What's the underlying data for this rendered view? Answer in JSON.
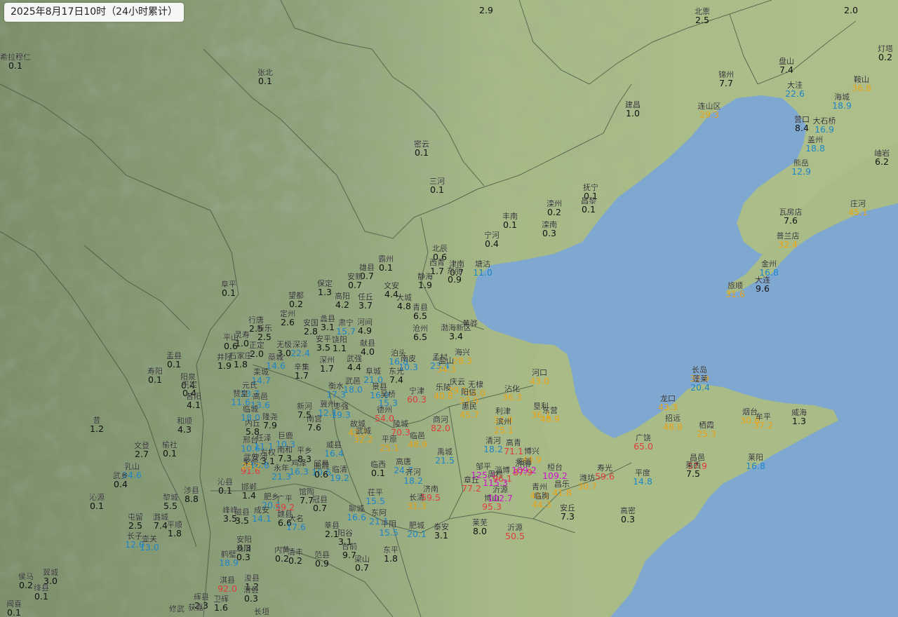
{
  "header": {
    "title": "2025年8月17日10时（24小时累计）"
  },
  "colors": {
    "sea": "#7ea8cf",
    "plain": "#a8bb86",
    "mountain": "#7f936d",
    "border": "#3a4a3a",
    "r0": "#111111",
    "r10": "#1f86c8",
    "r25": "#e8a317",
    "r50": "#e03c3c",
    "r100": "#cc14cc"
  },
  "stations": [
    {
      "name": "",
      "value": "2.9"
    },
    {
      "name": "",
      "value": "2.0"
    },
    {
      "name": "北票",
      "value": "2.5"
    },
    {
      "name": "希拉穆仁",
      "value": "0.1"
    },
    {
      "name": "张北",
      "value": "0.1"
    },
    {
      "name": "盘山",
      "value": "7.4"
    },
    {
      "name": "灯塔",
      "value": "0.2"
    },
    {
      "name": "锦州",
      "value": "7.7"
    },
    {
      "name": "鞍山",
      "value": "36.8"
    },
    {
      "name": "大洼",
      "value": "22.6"
    },
    {
      "name": "海城",
      "value": "18.9"
    },
    {
      "name": "建昌",
      "value": "1.0"
    },
    {
      "name": "连山区",
      "value": "29.3"
    },
    {
      "name": "营口",
      "value": "8.4"
    },
    {
      "name": "大石桥",
      "value": "16.9"
    },
    {
      "name": "盖州",
      "value": "18.8"
    },
    {
      "name": "岫岩",
      "value": "6.2"
    },
    {
      "name": "密云",
      "value": "0.1"
    },
    {
      "name": "熊岳",
      "value": "12.9"
    },
    {
      "name": "三河",
      "value": "0.1"
    },
    {
      "name": "抚宁",
      "value": "0.1"
    },
    {
      "name": "昌黎",
      "value": "0.1"
    },
    {
      "name": "滦州",
      "value": "0.2"
    },
    {
      "name": "庄河",
      "value": "45.1"
    },
    {
      "name": "丰南",
      "value": "0.1"
    },
    {
      "name": "滦南",
      "value": "0.3"
    },
    {
      "name": "瓦房店",
      "value": "7.6"
    },
    {
      "name": "宁河",
      "value": "0.4"
    },
    {
      "name": "普兰店",
      "value": "32.4"
    },
    {
      "name": "北辰",
      "value": "0.6"
    },
    {
      "name": "霸州",
      "value": "0.1"
    },
    {
      "name": "西青",
      "value": "1.7"
    },
    {
      "name": "津南",
      "value": "0.7"
    },
    {
      "name": "东丽",
      "value": "0.9"
    },
    {
      "name": "塘沽",
      "value": "11.0"
    },
    {
      "name": "雄县",
      "value": "0.7"
    },
    {
      "name": "金州",
      "value": "16.8"
    },
    {
      "name": "安新",
      "value": "0.7"
    },
    {
      "name": "静海",
      "value": "1.9"
    },
    {
      "name": "阜平",
      "value": "0.1"
    },
    {
      "name": "保定",
      "value": "1.3"
    },
    {
      "name": "文安",
      "value": "4.4"
    },
    {
      "name": "大连",
      "value": "9.6"
    },
    {
      "name": "旅顺",
      "value": "31.6"
    },
    {
      "name": "望都",
      "value": "0.2"
    },
    {
      "name": "高阳",
      "value": "4.2"
    },
    {
      "name": "任丘",
      "value": "3.7"
    },
    {
      "name": "大城",
      "value": "4.8"
    },
    {
      "name": "青县",
      "value": "6.5"
    },
    {
      "name": "定州",
      "value": "2.6"
    },
    {
      "name": "行唐",
      "value": "2.5"
    },
    {
      "name": "蠡县",
      "value": "3.1"
    },
    {
      "name": "安国",
      "value": "2.8"
    },
    {
      "name": "肃宁",
      "value": "15.7"
    },
    {
      "name": "河间",
      "value": "4.9"
    },
    {
      "name": "沧州",
      "value": "6.5"
    },
    {
      "name": "渤海新区",
      "value": "3.4"
    },
    {
      "name": "黄骅",
      "value": ""
    },
    {
      "name": "新乐",
      "value": "2.5"
    },
    {
      "name": "灵寿",
      "value": "1.0"
    },
    {
      "name": "平山",
      "value": "0.6"
    },
    {
      "name": "无极",
      "value": "3.0"
    },
    {
      "name": "深泽",
      "value": "22.4"
    },
    {
      "name": "安平",
      "value": "3.5"
    },
    {
      "name": "饶阳",
      "value": "1.1"
    },
    {
      "name": "献县",
      "value": "4.0"
    },
    {
      "name": "石家庄",
      "value": "1.8"
    },
    {
      "name": "正定",
      "value": "2.0"
    },
    {
      "name": "盂县",
      "value": "0.1"
    },
    {
      "name": "井陉",
      "value": "1.9"
    },
    {
      "name": "藁城",
      "value": "14.6"
    },
    {
      "name": "泊头",
      "value": "16.8"
    },
    {
      "name": "南皮",
      "value": "10.3"
    },
    {
      "name": "孟村",
      "value": "23.4"
    },
    {
      "name": "盐山",
      "value": "34.3"
    },
    {
      "name": "海兴",
      "value": "28.3"
    },
    {
      "name": "寿阳",
      "value": "0.1"
    },
    {
      "name": "深州",
      "value": "1.7"
    },
    {
      "name": "武强",
      "value": "4.4"
    },
    {
      "name": "阜城",
      "value": "21.0"
    },
    {
      "name": "辛集",
      "value": "1.7"
    },
    {
      "name": "栾城",
      "value": "14.7"
    },
    {
      "name": "东光",
      "value": "7.4"
    },
    {
      "name": "阳泉",
      "value": "0.4"
    },
    {
      "name": "平定",
      "value": "0.4"
    },
    {
      "name": "元氏",
      "value": "23.7"
    },
    {
      "name": "武邑",
      "value": "18.0"
    },
    {
      "name": "河口",
      "value": "43.0"
    },
    {
      "name": "昔阳",
      "value": "4.1"
    },
    {
      "name": "衡水",
      "value": "17.3"
    },
    {
      "name": "景县",
      "value": "16.9"
    },
    {
      "name": "吴桥",
      "value": "15.3"
    },
    {
      "name": "宁津",
      "value": "60.3"
    },
    {
      "name": "乐陵",
      "value": "40.8"
    },
    {
      "name": "庆云",
      "value": "29.1"
    },
    {
      "name": "无棣",
      "value": "34.0"
    },
    {
      "name": "沾化",
      "value": "36.3"
    },
    {
      "name": "赞皇",
      "value": "11.6"
    },
    {
      "name": "高邑",
      "value": "13.6"
    },
    {
      "name": "阳信",
      "value": "33.0"
    },
    {
      "name": "垦利",
      "value": "36.1"
    },
    {
      "name": "长岛",
      "value": "32.9"
    },
    {
      "name": "蓬莱",
      "value": "20.4"
    },
    {
      "name": "临城",
      "value": "18.0"
    },
    {
      "name": "新河",
      "value": "7.5"
    },
    {
      "name": "冀州",
      "value": "12.1"
    },
    {
      "name": "枣强",
      "value": "19.3"
    },
    {
      "name": "德州",
      "value": "54.0"
    },
    {
      "name": "惠民",
      "value": "45.7"
    },
    {
      "name": "利津",
      "value": "34.8"
    },
    {
      "name": "东营",
      "value": "48.9"
    },
    {
      "name": "龙口",
      "value": "43.3"
    },
    {
      "name": "昔",
      "value": "1.2"
    },
    {
      "name": "和顺",
      "value": "4.3"
    },
    {
      "name": "内丘",
      "value": "5.8"
    },
    {
      "name": "隆尧",
      "value": "7.9"
    },
    {
      "name": "南宫",
      "value": "7.6"
    },
    {
      "name": "故城",
      "value": "42.3"
    },
    {
      "name": "陵城",
      "value": "70.3"
    },
    {
      "name": "商河",
      "value": "82.0"
    },
    {
      "name": "滨州",
      "value": "25.1"
    },
    {
      "name": "招远",
      "value": "48.8"
    },
    {
      "name": "烟台",
      "value": "30.8"
    },
    {
      "name": "牟平",
      "value": "37.2"
    },
    {
      "name": "威海",
      "value": "1.3"
    },
    {
      "name": "邢台",
      "value": "10.6"
    },
    {
      "name": "任泽",
      "value": "11.1"
    },
    {
      "name": "巨鹿",
      "value": "10.3"
    },
    {
      "name": "武城",
      "value": "32.2"
    },
    {
      "name": "平原",
      "value": "25.1"
    },
    {
      "name": "临邑",
      "value": "48.9"
    },
    {
      "name": "栖霞",
      "value": "25.3"
    },
    {
      "name": "文登",
      "value": "2.7"
    },
    {
      "name": "榆社",
      "value": "0.1"
    },
    {
      "name": "左权",
      "value": "3.1"
    },
    {
      "name": "南和",
      "value": "7.3"
    },
    {
      "name": "平乡",
      "value": "8.3"
    },
    {
      "name": "威县",
      "value": "16.4"
    },
    {
      "name": "清河",
      "value": "18.2"
    },
    {
      "name": "高青",
      "value": "71.1"
    },
    {
      "name": "博兴",
      "value": "44.9"
    },
    {
      "name": "广饶",
      "value": "65.0"
    },
    {
      "name": "莱州",
      "value": "91.6"
    },
    {
      "name": "沙河",
      "value": "10.6"
    },
    {
      "name": "鸡泽",
      "value": "16.3"
    },
    {
      "name": "邱县",
      "value": "10.6"
    },
    {
      "name": "临西",
      "value": "0.1"
    },
    {
      "name": "高唐",
      "value": "24.7"
    },
    {
      "name": "禹城",
      "value": "21.5"
    },
    {
      "name": "济阳",
      "value": "87.9"
    },
    {
      "name": "桓台",
      "value": "109.2"
    },
    {
      "name": "寿光",
      "value": "59.6"
    },
    {
      "name": "昌邑",
      "value": "57.9"
    },
    {
      "name": "莱阳",
      "value": "16.8"
    },
    {
      "name": "乳山",
      "value": "24.6"
    },
    {
      "name": "武乡",
      "value": "0.4"
    },
    {
      "name": "沁县",
      "value": "0.1"
    },
    {
      "name": "武安",
      "value": "25.2"
    },
    {
      "name": "永年",
      "value": "21.3"
    },
    {
      "name": "曲周",
      "value": "0.6"
    },
    {
      "name": "临清",
      "value": "19.2"
    },
    {
      "name": "齐河",
      "value": "18.2"
    },
    {
      "name": "邹平",
      "value": "125.4"
    },
    {
      "name": "周村",
      "value": "115.3"
    },
    {
      "name": "淄博",
      "value": "96.1"
    },
    {
      "name": "临淄",
      "value": "109.2"
    },
    {
      "name": "青州",
      "value": "40.5"
    },
    {
      "name": "昌乐",
      "value": "41.8"
    },
    {
      "name": "潍坊",
      "value": "30.7"
    },
    {
      "name": "平度",
      "value": "14.8"
    },
    {
      "name": "莱西",
      "value": "7.5"
    },
    {
      "name": "沁源",
      "value": "0.1"
    },
    {
      "name": "黎城",
      "value": "5.5"
    },
    {
      "name": "涉县",
      "value": "8.8"
    },
    {
      "name": "邯郸",
      "value": "1.4"
    },
    {
      "name": "肥乡",
      "value": "20.1"
    },
    {
      "name": "馆陶",
      "value": "7.7"
    },
    {
      "name": "冠县",
      "value": "0.7"
    },
    {
      "name": "茌平",
      "value": "15.5"
    },
    {
      "name": "长清",
      "value": "31.3"
    },
    {
      "name": "济南",
      "value": "59.5"
    },
    {
      "name": "章丘",
      "value": "77.2"
    },
    {
      "name": "博山",
      "value": "95.3"
    },
    {
      "name": "沂源",
      "value": "102.7"
    },
    {
      "name": "临朐",
      "value": "44.3"
    },
    {
      "name": "安丘",
      "value": "7.3"
    },
    {
      "name": "高密",
      "value": "0.3"
    },
    {
      "name": "屯留",
      "value": "2.5"
    },
    {
      "name": "潞城",
      "value": "7.4"
    },
    {
      "name": "峰峰",
      "value": "3.5"
    },
    {
      "name": "磁县",
      "value": "3.5"
    },
    {
      "name": "成安",
      "value": "14.1"
    },
    {
      "name": "广平",
      "value": "59.2"
    },
    {
      "name": "魏县",
      "value": "6.6"
    },
    {
      "name": "大名",
      "value": "17.6"
    },
    {
      "name": "聊城",
      "value": "16.6"
    },
    {
      "name": "东阿",
      "value": "21.1"
    },
    {
      "name": "平阴",
      "value": "15.5"
    },
    {
      "name": "肥城",
      "value": "20.1"
    },
    {
      "name": "泰安",
      "value": "3.1"
    },
    {
      "name": "莱芜",
      "value": "8.0"
    },
    {
      "name": "沂源",
      "value": "50.5"
    },
    {
      "name": "长子",
      "value": "12.0"
    },
    {
      "name": "壶关",
      "value": "13.0"
    },
    {
      "name": "平顺",
      "value": "1.8"
    },
    {
      "name": "安阳",
      "value": "0.3"
    },
    {
      "name": "汤阴",
      "value": "0.3"
    },
    {
      "name": "莘县",
      "value": "2.1"
    },
    {
      "name": "阳谷",
      "value": "3.1"
    },
    {
      "name": "台前",
      "value": "9.7"
    },
    {
      "name": "东平",
      "value": "1.8"
    },
    {
      "name": "鹤壁",
      "value": "18.9"
    },
    {
      "name": "内黄",
      "value": "0.2"
    },
    {
      "name": "清丰",
      "value": "0.2"
    },
    {
      "name": "范县",
      "value": "0.9"
    },
    {
      "name": "梁山",
      "value": "0.7"
    },
    {
      "name": "侯马",
      "value": "0.2"
    },
    {
      "name": "翼城",
      "value": "3.0"
    },
    {
      "name": "绛县",
      "value": "0.1"
    },
    {
      "name": "淇县",
      "value": "92.0"
    },
    {
      "name": "浚县",
      "value": "1.2"
    },
    {
      "name": "滑县",
      "value": "0.3"
    },
    {
      "name": "辉县",
      "value": "2.3"
    },
    {
      "name": "卫辉",
      "value": "1.6"
    },
    {
      "name": "闻喜",
      "value": "0.1"
    },
    {
      "name": "修武",
      "value": ""
    },
    {
      "name": "获嘉",
      "value": ""
    },
    {
      "name": "长垣",
      "value": ""
    }
  ]
}
